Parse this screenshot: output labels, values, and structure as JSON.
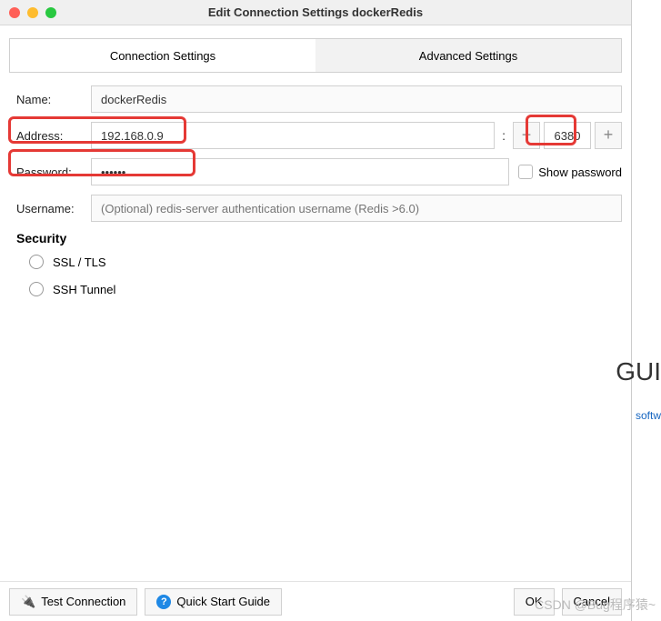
{
  "window": {
    "title": "Edit Connection Settings dockerRedis"
  },
  "tabs": {
    "connection": "Connection Settings",
    "advanced": "Advanced Settings"
  },
  "form": {
    "name_label": "Name:",
    "name_value": "dockerRedis",
    "address_label": "Address:",
    "address_value": "192.168.0.9",
    "port_value": "6380",
    "password_label": "Password:",
    "password_value": "••••••",
    "show_password_label": "Show password",
    "username_label": "Username:",
    "username_placeholder": "(Optional) redis-server authentication username (Redis >6.0)"
  },
  "security": {
    "heading": "Security",
    "ssl_label": "SSL / TLS",
    "ssh_label": "SSH Tunnel"
  },
  "footer": {
    "test_connection": "Test Connection",
    "quick_start": "Quick Start Guide",
    "ok": "OK",
    "cancel": "Cancel"
  },
  "background": {
    "fragment": "GUI",
    "link": "softw"
  },
  "watermark": "CSDN @Bug程序猿~"
}
